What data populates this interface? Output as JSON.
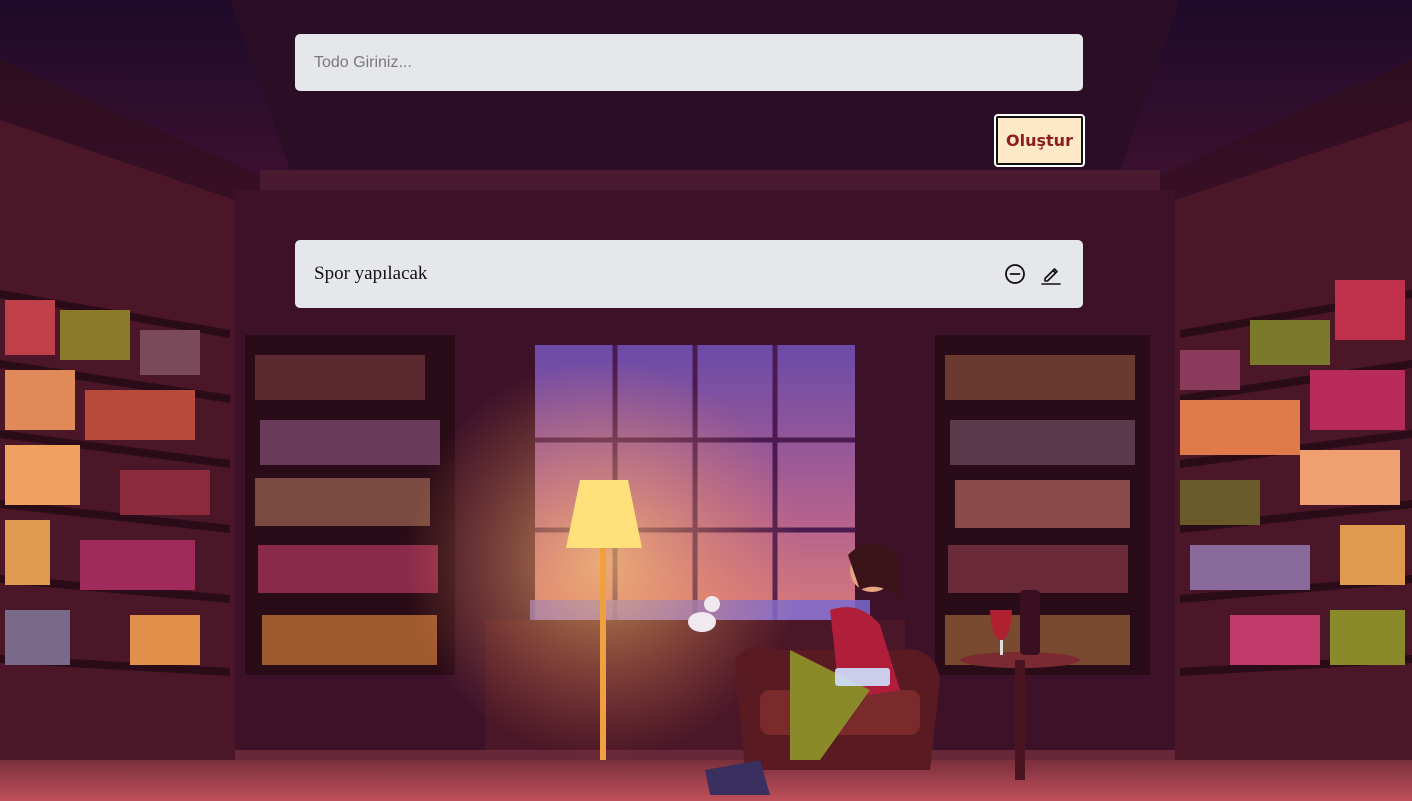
{
  "form": {
    "input_placeholder": "Todo Giriniz...",
    "input_value": "",
    "create_button_label": "Oluştur"
  },
  "todos": [
    {
      "text": "Spor yapılacak",
      "actions": [
        {
          "name": "delete",
          "icon": "minus-circle-icon"
        },
        {
          "name": "edit",
          "icon": "pencil-icon"
        }
      ]
    }
  ],
  "colors": {
    "field_background": "#e5e7eb",
    "button_background": "#fde8c8",
    "button_text": "#8b1e1e"
  }
}
